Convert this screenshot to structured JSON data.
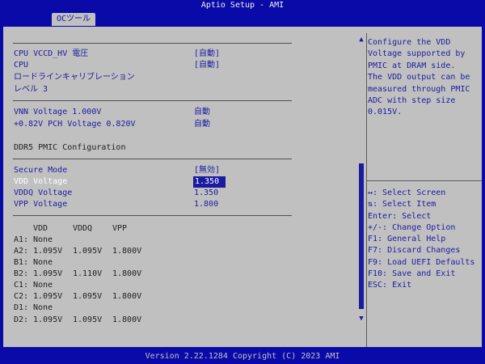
{
  "title": "Aptio Setup - AMI",
  "tab": "OCツール",
  "footer": "Version 2.22.1284 Copyright (C) 2023 AMI",
  "items": [
    {
      "label": "CPU VCCD_HV 電圧",
      "value": "[自動]"
    },
    {
      "label": "CPU",
      "value": "[自動]"
    },
    {
      "label": "ロードラインキャリブレーション",
      "value": ""
    },
    {
      "label": "レベル 3",
      "value": ""
    },
    {
      "label": "VNN Voltage  1.000V",
      "value": "自動"
    },
    {
      "label": "+0.82V PCH Voltage  0.820V",
      "value": "自動"
    },
    {
      "label": "DDR5 PMIC Configuration",
      "value": ""
    },
    {
      "label": "Secure Mode",
      "value": "[無効]"
    },
    {
      "label": "VDD  Voltage",
      "value": "1.350"
    },
    {
      "label": "VDDQ Voltage",
      "value": "1.350"
    },
    {
      "label": "VPP  Voltage",
      "value": "1.800"
    }
  ],
  "pmic_table": {
    "headers": [
      "VDD",
      "VDDQ",
      "VPP"
    ],
    "rows": [
      {
        "label": "A1:",
        "vdd": "None",
        "vddq": "",
        "vpp": ""
      },
      {
        "label": "A2:",
        "vdd": "1.095V",
        "vddq": "1.095V",
        "vpp": "1.800V"
      },
      {
        "label": "B1:",
        "vdd": "None",
        "vddq": "",
        "vpp": ""
      },
      {
        "label": "B2:",
        "vdd": "1.095V",
        "vddq": "1.110V",
        "vpp": "1.800V"
      },
      {
        "label": "C1:",
        "vdd": "None",
        "vddq": "",
        "vpp": ""
      },
      {
        "label": "C2:",
        "vdd": "1.095V",
        "vddq": "1.095V",
        "vpp": "1.800V"
      },
      {
        "label": "D1:",
        "vdd": "None",
        "vddq": "",
        "vpp": ""
      },
      {
        "label": "D2:",
        "vdd": "1.095V",
        "vddq": "1.095V",
        "vpp": "1.800V"
      }
    ]
  },
  "help_text": "Configure the VDD\nVoltage supported by\nPMIC at DRAM side.\nThe VDD output can be\nmeasured through PMIC\nADC with step size\n0.015V.",
  "keys": [
    "↔: Select Screen",
    "⇅: Select Item",
    "Enter: Select",
    "+/-: Change Option",
    "F1: General Help",
    "F7: Discard Changes",
    "F9: Load UEFI Defaults",
    "F10: Save and Exit",
    "ESC: Exit"
  ],
  "colors": {
    "background": "#0a0aa8",
    "panel": "#c0c0c0",
    "accent": "#1b1ba0"
  }
}
